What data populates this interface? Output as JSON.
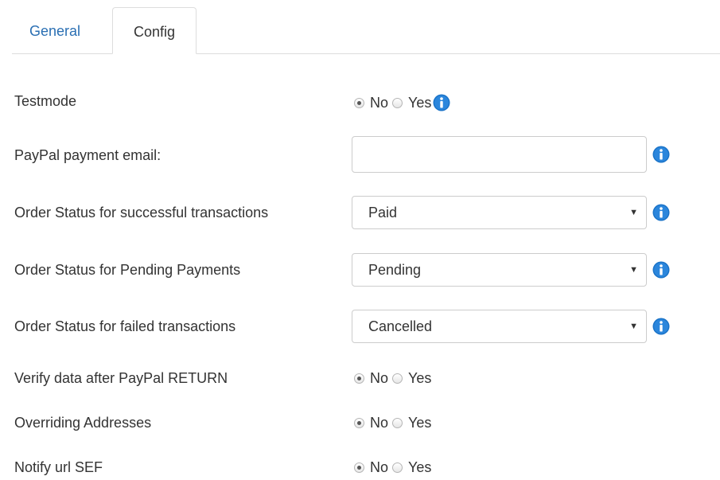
{
  "tabs": [
    {
      "label": "General",
      "active": false
    },
    {
      "label": "Config",
      "active": true
    }
  ],
  "fields": {
    "testmode": {
      "label": "Testmode",
      "selected": "No",
      "options": [
        "No",
        "Yes"
      ]
    },
    "paypal_email": {
      "label": "PayPal payment email:",
      "value": ""
    },
    "status_success": {
      "label": "Order Status for successful transactions",
      "value": "Paid"
    },
    "status_pending": {
      "label": "Order Status for Pending Payments",
      "value": "Pending"
    },
    "status_failed": {
      "label": "Order Status for failed transactions",
      "value": "Cancelled"
    },
    "verify_return": {
      "label": "Verify data after PayPal RETURN",
      "selected": "No",
      "options": [
        "No",
        "Yes"
      ]
    },
    "overriding_addresses": {
      "label": "Overriding Addresses",
      "selected": "No",
      "options": [
        "No",
        "Yes"
      ]
    },
    "notify_sef": {
      "label": "Notify url SEF",
      "selected": "No",
      "options": [
        "No",
        "Yes"
      ]
    }
  },
  "colors": {
    "accent": "#2a6fb3",
    "info_icon": "#1a73c8"
  },
  "icons": {
    "info": "info-icon",
    "dropdown": "chevron-down-icon"
  }
}
